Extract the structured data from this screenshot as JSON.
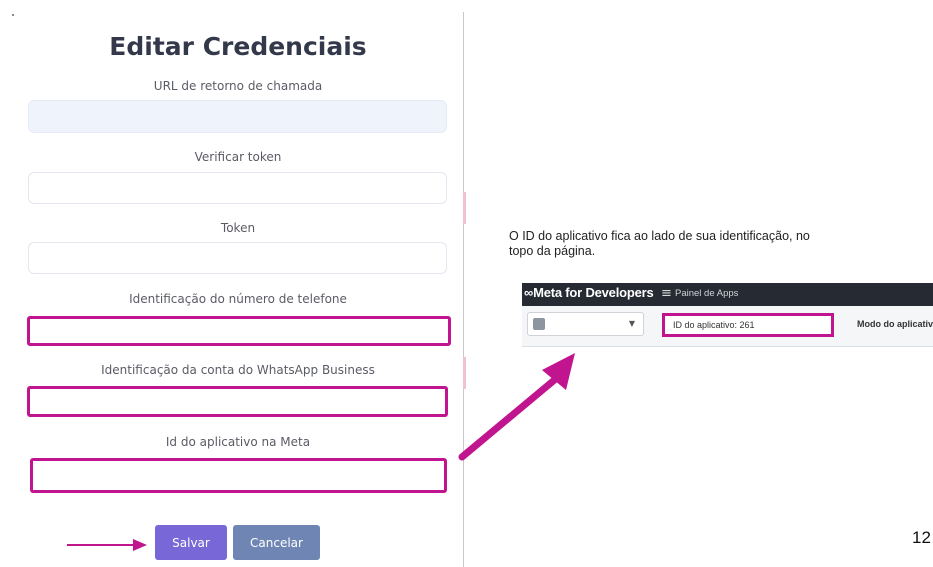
{
  "form": {
    "title": "Editar Credenciais",
    "fields": [
      {
        "label": "URL de retorno de chamada",
        "value": "",
        "placeholder": ""
      },
      {
        "label": "Verificar token",
        "value": "",
        "placeholder": ""
      },
      {
        "label": "Token",
        "value": "",
        "placeholder": ""
      },
      {
        "label": "Identificação do número de telefone",
        "value": "",
        "placeholder": ""
      },
      {
        "label": "Identificação da conta do WhatsApp Business",
        "value": "",
        "placeholder": ""
      },
      {
        "label": "Id do aplicativo na Meta",
        "value": "",
        "placeholder": ""
      }
    ],
    "save_label": "Salvar",
    "cancel_label": "Cancelar"
  },
  "help": {
    "text": "O ID do aplicativo fica ao lado de sua identificação, no topo da página."
  },
  "meta_screenshot": {
    "logo": "∞Meta for Developers",
    "menu_icon": "menu-icon",
    "panel_label": "Painel de Apps",
    "app_id_label": "ID do aplicativo: 261",
    "mode_label": "Modo do aplicativo"
  },
  "page_number": "12",
  "colors": {
    "highlight": "#c0158f",
    "save_button": "#7867d6",
    "cancel_button": "#6f86b5",
    "title": "#33394a"
  }
}
